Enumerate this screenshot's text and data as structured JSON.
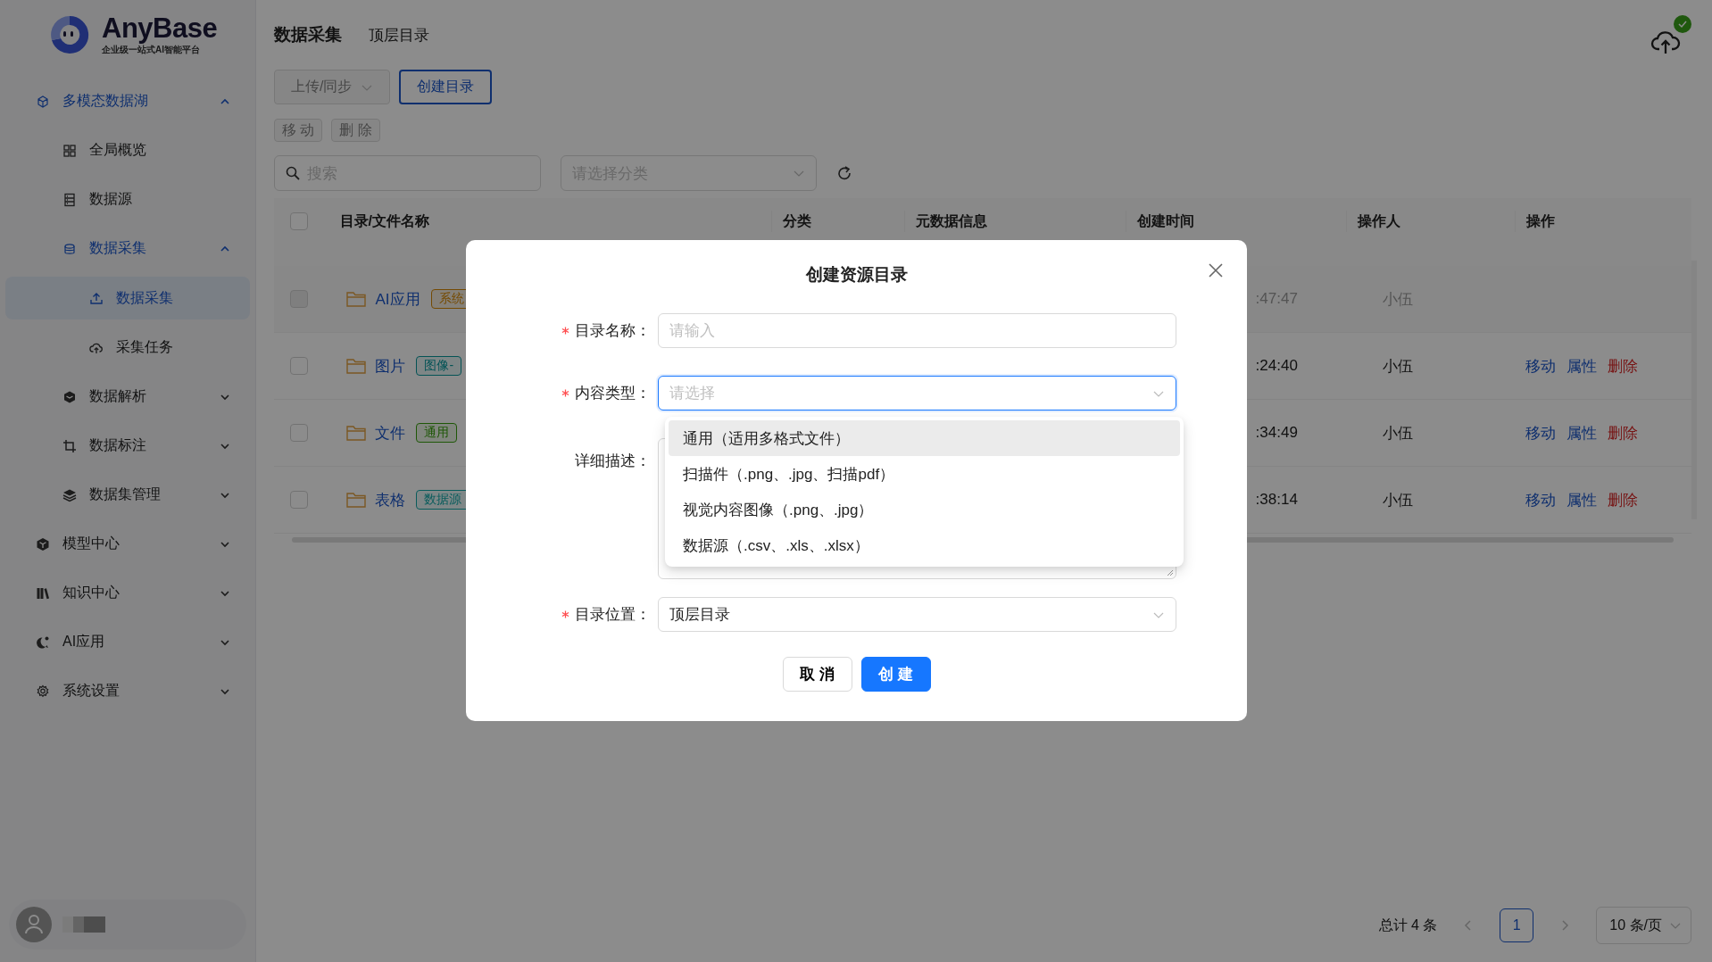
{
  "sidebar": {
    "logo": {
      "name": "AnyBase",
      "tagline": "企业级一站式AI智能平台"
    },
    "menu": [
      {
        "label": "多模态数据湖",
        "expanded": true,
        "selected": false,
        "children": [
          {
            "label": "全局概览",
            "selected": false
          },
          {
            "label": "数据源",
            "selected": false
          },
          {
            "label": "数据采集",
            "expanded": true,
            "selected": false,
            "children": [
              {
                "label": "数据采集",
                "selected": true
              },
              {
                "label": "采集任务",
                "selected": false
              }
            ]
          },
          {
            "label": "数据解析",
            "expanded": false,
            "selected": false
          },
          {
            "label": "数据标注",
            "expanded": false,
            "selected": false
          },
          {
            "label": "数据集管理",
            "expanded": false,
            "selected": false
          }
        ]
      },
      {
        "label": "模型中心",
        "expanded": false,
        "selected": false
      },
      {
        "label": "知识中心",
        "expanded": false,
        "selected": false
      },
      {
        "label": "AI应用",
        "expanded": false,
        "selected": false
      },
      {
        "label": "系统设置",
        "expanded": false,
        "selected": false
      }
    ]
  },
  "header": {
    "title": "数据采集",
    "breadcrumb": "顶层目录",
    "sync_done": true
  },
  "toolbar": {
    "buttons": [
      {
        "label": "上传/同步",
        "kind": "dropdown",
        "disabled": true
      },
      {
        "label": "创建目录",
        "kind": "outline",
        "disabled": false
      }
    ],
    "batch_buttons": [
      {
        "label": "移 动",
        "disabled": true
      },
      {
        "label": "删 除",
        "disabled": true
      }
    ]
  },
  "search": {
    "placeholder": "搜索"
  },
  "category_select": {
    "placeholder": "请选择分类"
  },
  "table": {
    "select_all": false,
    "columns": [
      "目录/文件名称",
      "分类",
      "元数据信息",
      "创建时间",
      "操作人",
      "操作"
    ],
    "rows": [
      {
        "checked": false,
        "disabled": true,
        "name": "AI应用",
        "tag": {
          "text": "系统",
          "kind": "system"
        },
        "time": ":47:47",
        "operator": "小伍",
        "actions": []
      },
      {
        "checked": false,
        "disabled": false,
        "name": "图片",
        "tag": {
          "text": "图像-",
          "kind": "image"
        },
        "time": ":24:40",
        "operator": "小伍",
        "actions": [
          {
            "label": "移动",
            "kind": "link"
          },
          {
            "label": "属性",
            "kind": "link"
          },
          {
            "label": "删除",
            "kind": "danger"
          }
        ]
      },
      {
        "checked": false,
        "disabled": false,
        "name": "文件",
        "tag": {
          "text": "通用",
          "kind": "general"
        },
        "time": ":34:49",
        "operator": "小伍",
        "actions": [
          {
            "label": "移动",
            "kind": "link"
          },
          {
            "label": "属性",
            "kind": "link"
          },
          {
            "label": "删除",
            "kind": "danger"
          }
        ]
      },
      {
        "checked": false,
        "disabled": false,
        "name": "表格",
        "tag": {
          "text": "数据源",
          "kind": "datasource"
        },
        "time": ":38:14",
        "operator": "小伍",
        "actions": [
          {
            "label": "移动",
            "kind": "link"
          },
          {
            "label": "属性",
            "kind": "link"
          },
          {
            "label": "删除",
            "kind": "danger"
          }
        ]
      }
    ]
  },
  "pagination": {
    "total": "总计 4 条",
    "pages": [
      {
        "label": "1",
        "selected": true
      }
    ],
    "page_size": "10 条/页"
  },
  "modal": {
    "title": "创建资源目录",
    "fields": [
      {
        "kind": "input",
        "label": "目录名称：",
        "required": true,
        "placeholder": "请输入"
      },
      {
        "kind": "select",
        "label": "内容类型：",
        "required": true,
        "placeholder": "请选择",
        "focused": true
      },
      {
        "kind": "textarea",
        "label": "详细描述：",
        "required": false
      },
      {
        "kind": "select",
        "label": "目录位置：",
        "required": true,
        "value": "顶层目录",
        "focused": false
      }
    ],
    "dropdown": [
      {
        "label": "通用（适用多格式文件）",
        "highlighted": true
      },
      {
        "label": "扫描件（.png、.jpg、扫描pdf）",
        "highlighted": false
      },
      {
        "label": "视觉内容图像（.png、.jpg）",
        "highlighted": false
      },
      {
        "label": "数据源（.csv、.xls、.xlsx）",
        "highlighted": false
      }
    ],
    "buttons": [
      {
        "label": "取 消",
        "kind": "default"
      },
      {
        "label": "创 建",
        "kind": "primary"
      }
    ]
  }
}
